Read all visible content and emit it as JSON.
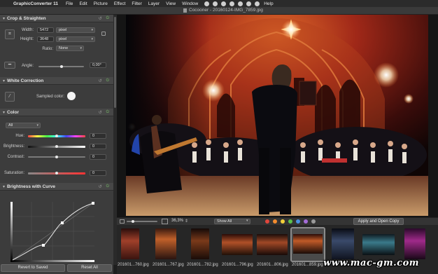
{
  "menubar": {
    "apple_icon": "apple-logo-icon",
    "app_name": "GraphicConverter 11",
    "items": [
      "File",
      "Edit",
      "Picture",
      "Effect",
      "Filter",
      "Layer",
      "View",
      "Window",
      "Help"
    ]
  },
  "window": {
    "title": "Cocooner - 20160124-IMG_7859.jpg"
  },
  "panel": {
    "crop": {
      "title": "Crop & Straighten",
      "width_label": "Width:",
      "width_value": "5472",
      "width_unit": "pixel",
      "height_label": "Height:",
      "height_value": "3648",
      "height_unit": "pixel",
      "ratio_label": "Ratio:",
      "ratio_value": "None",
      "angle_label": "Angle:",
      "angle_value": "0,00°"
    },
    "white": {
      "title": "White Correction",
      "sampled_label": "Sampled color:"
    },
    "color": {
      "title": "Color",
      "channel": "All",
      "hue_label": "Hue:",
      "hue_value": "0",
      "brightness_label": "Brightness:",
      "brightness_value": "0",
      "contrast_label": "Contrast:",
      "contrast_value": "0",
      "saturation_label": "Saturation:",
      "saturation_value": "0"
    },
    "curve": {
      "title": "Brightness with Curve"
    },
    "revert_label": "Revert to Saved",
    "reset_label": "Reset All"
  },
  "toolbar": {
    "zoom": "36,3%",
    "filter": "Show All",
    "apply_label": "Apply and Open Copy",
    "label_colors": [
      "#e0463c",
      "#f28b2e",
      "#f2cf3a",
      "#5cc24a",
      "#4a90e2",
      "#a46cd8",
      "#9a9a9a"
    ]
  },
  "thumbnails": [
    {
      "label": "201601...760.jpg"
    },
    {
      "label": "201601...767.jpg"
    },
    {
      "label": "201601...782.jpg"
    },
    {
      "label": "201601...796.jpg"
    },
    {
      "label": "201601...806.jpg"
    },
    {
      "label": "201601...859.jpg"
    },
    {
      "label": ""
    },
    {
      "label": ""
    },
    {
      "label": ""
    }
  ],
  "watermark": "www.mac-gm.com",
  "colors": {
    "panel_bg": "#3c3c3c",
    "section_header": "#474747",
    "accent_green": "#7bc36b"
  }
}
